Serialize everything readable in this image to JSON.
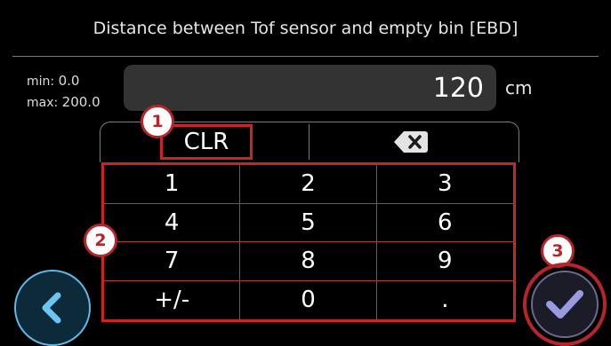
{
  "header": {
    "title": "Distance between Tof sensor and empty bin [EBD]"
  },
  "range": {
    "min_label": "min:",
    "min_value": "0.0",
    "max_label": "max:",
    "max_value": "200.0"
  },
  "input": {
    "value": "120",
    "unit": "cm"
  },
  "keypad": {
    "clear_label": "CLR",
    "backspace_icon": "backspace-icon",
    "keys": [
      "1",
      "2",
      "3",
      "4",
      "5",
      "6",
      "7",
      "8",
      "9",
      "+/-",
      "0",
      "."
    ]
  },
  "annotations": {
    "badge_1": "1",
    "badge_2": "2",
    "badge_3": "3"
  },
  "navigation": {
    "back_icon": "chevron-left-icon",
    "confirm_icon": "checkmark-icon"
  },
  "colors": {
    "highlight": "#c8242a",
    "back_accent": "#5fb8e6",
    "confirm_accent": "#8e8ed8"
  }
}
